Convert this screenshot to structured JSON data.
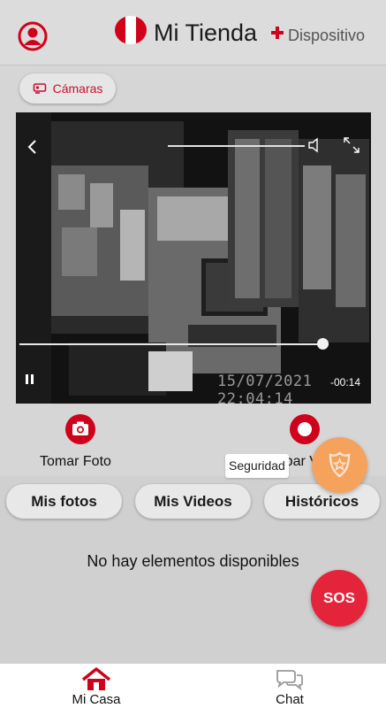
{
  "header": {
    "title": "Mi Tienda",
    "subtitle": "Dispositivo",
    "flag_colors": [
      "#d0021b",
      "#ffffff",
      "#d0021b"
    ]
  },
  "camera_chip": {
    "label": "Cámaras",
    "icon": "cctv-camera-icon"
  },
  "video": {
    "timestamp": "15/07/2021  22:04:14",
    "elapsed": "-00:14",
    "progress": 0.97,
    "volume": 1.0
  },
  "actions": {
    "photo_label": "Tomar Foto",
    "record_label": "Grabar Video"
  },
  "tooltip": "Seguridad",
  "tabs": [
    "Mis fotos",
    "Mis Videos",
    "Históricos"
  ],
  "empty_message": "No hay elementos disponibles",
  "sos_label": "SOS",
  "bottom_nav": [
    {
      "label": "Mi Casa",
      "icon": "home-icon",
      "active": true
    },
    {
      "label": "Chat",
      "icon": "chat-icon",
      "active": false
    }
  ],
  "colors": {
    "accent": "#d0021b",
    "sos": "#e4243a",
    "security": "#f5a25d"
  }
}
